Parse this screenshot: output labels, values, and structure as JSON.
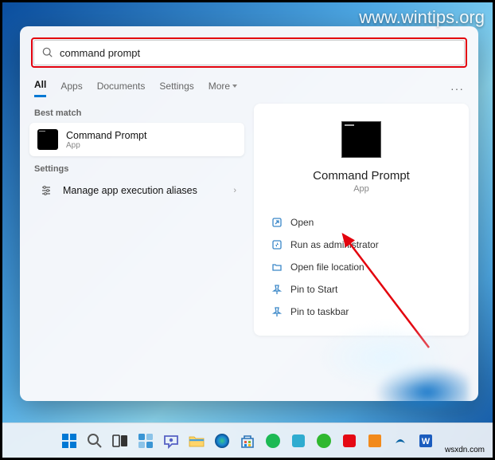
{
  "watermark": {
    "top": "www.wintips.org",
    "bottom": "wsxdn.com"
  },
  "search": {
    "query": "command prompt"
  },
  "tabs": [
    "All",
    "Apps",
    "Documents",
    "Settings",
    "More"
  ],
  "overflow": "···",
  "left": {
    "bestMatchLabel": "Best match",
    "bestMatch": {
      "title": "Command Prompt",
      "subtitle": "App"
    },
    "settingsLabel": "Settings",
    "settingsItem": {
      "title": "Manage app execution aliases"
    }
  },
  "detail": {
    "title": "Command Prompt",
    "type": "App",
    "actions": [
      {
        "icon": "open",
        "label": "Open"
      },
      {
        "icon": "admin",
        "label": "Run as administrator"
      },
      {
        "icon": "folder",
        "label": "Open file location"
      },
      {
        "icon": "pin",
        "label": "Pin to Start"
      },
      {
        "icon": "pin",
        "label": "Pin to taskbar"
      }
    ]
  },
  "taskbar": [
    "start",
    "search",
    "taskview",
    "widgets",
    "chat",
    "explorer",
    "edge",
    "store",
    "spotify",
    "whatsapp",
    "wechat",
    "netflix",
    "feedback",
    "onedrive",
    "word"
  ],
  "colors": {
    "accent": "#0078d4",
    "highlight": "#e3020d"
  }
}
